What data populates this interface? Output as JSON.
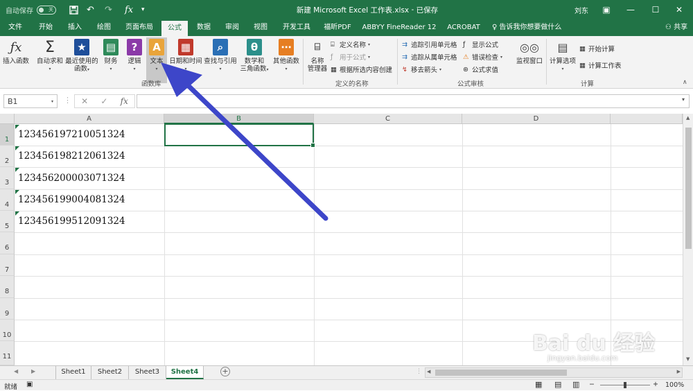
{
  "titlebar": {
    "autosave_label": "自动保存",
    "autosave_state": "关",
    "doc_title": "新建 Microsoft Excel 工作表.xlsx",
    "save_state": "已保存",
    "user": "刘东",
    "qa_undo": "↶",
    "qa_redo": "↷",
    "qa_fx": "fx"
  },
  "tabs": [
    "文件",
    "开始",
    "插入",
    "绘图",
    "页面布局",
    "公式",
    "数据",
    "审阅",
    "视图",
    "开发工具",
    "福昕PDF",
    "ABBYY FineReader 12",
    "ACROBAT"
  ],
  "tell_me": "告诉我你想要做什么",
  "share": "共享",
  "ribbon": {
    "insert_fn": "插入函数",
    "autosum": [
      "自动求和"
    ],
    "recent": [
      "最近使用的",
      "函数"
    ],
    "finance": "财务",
    "logic": "逻辑",
    "text": "文本",
    "datetime": "日期和时间",
    "lookup": "查找与引用",
    "math": [
      "数学和",
      "三角函数"
    ],
    "other": "其他函数",
    "group_fnlib": "函数库",
    "name_mgr": [
      "名称",
      "管理器"
    ],
    "define_name": "定义名称",
    "use_in_formula": "用于公式",
    "create_from_sel": "根据所选内容创建",
    "group_names": "定义的名称",
    "trace_prec": "追踪引用单元格",
    "trace_dep": "追踪从属单元格",
    "remove_arrows": "移去箭头",
    "show_formulas": "显示公式",
    "error_check": "错误检查",
    "eval_formula": "公式求值",
    "group_audit": "公式审核",
    "watch": "监视窗口",
    "calc_opts": "计算选项",
    "calc_now": "开始计算",
    "calc_sheet": "计算工作表",
    "group_calc": "计算"
  },
  "formula_bar": {
    "name_box": "B1",
    "fx": "fx",
    "content": ""
  },
  "grid": {
    "columns": [
      "A",
      "B",
      "C",
      "D"
    ],
    "rows": [
      "1",
      "2",
      "3",
      "4",
      "5",
      "6",
      "7",
      "8",
      "9",
      "10",
      "11"
    ],
    "cells_A": [
      "123456197210051324",
      "123456198212061324",
      "123456200003071324",
      "123456199004081324",
      "123456199512091324"
    ]
  },
  "sheets": [
    "Sheet1",
    "Sheet2",
    "Sheet3",
    "Sheet4"
  ],
  "active_sheet": "Sheet4",
  "status": {
    "ready": "就绪",
    "zoom": "100%"
  },
  "watermark": {
    "brand": "Bai du 经验",
    "url": "jingyan.baidu.com"
  },
  "colors": {
    "excel_green": "#217346",
    "arrow_blue": "#3d46c9"
  }
}
